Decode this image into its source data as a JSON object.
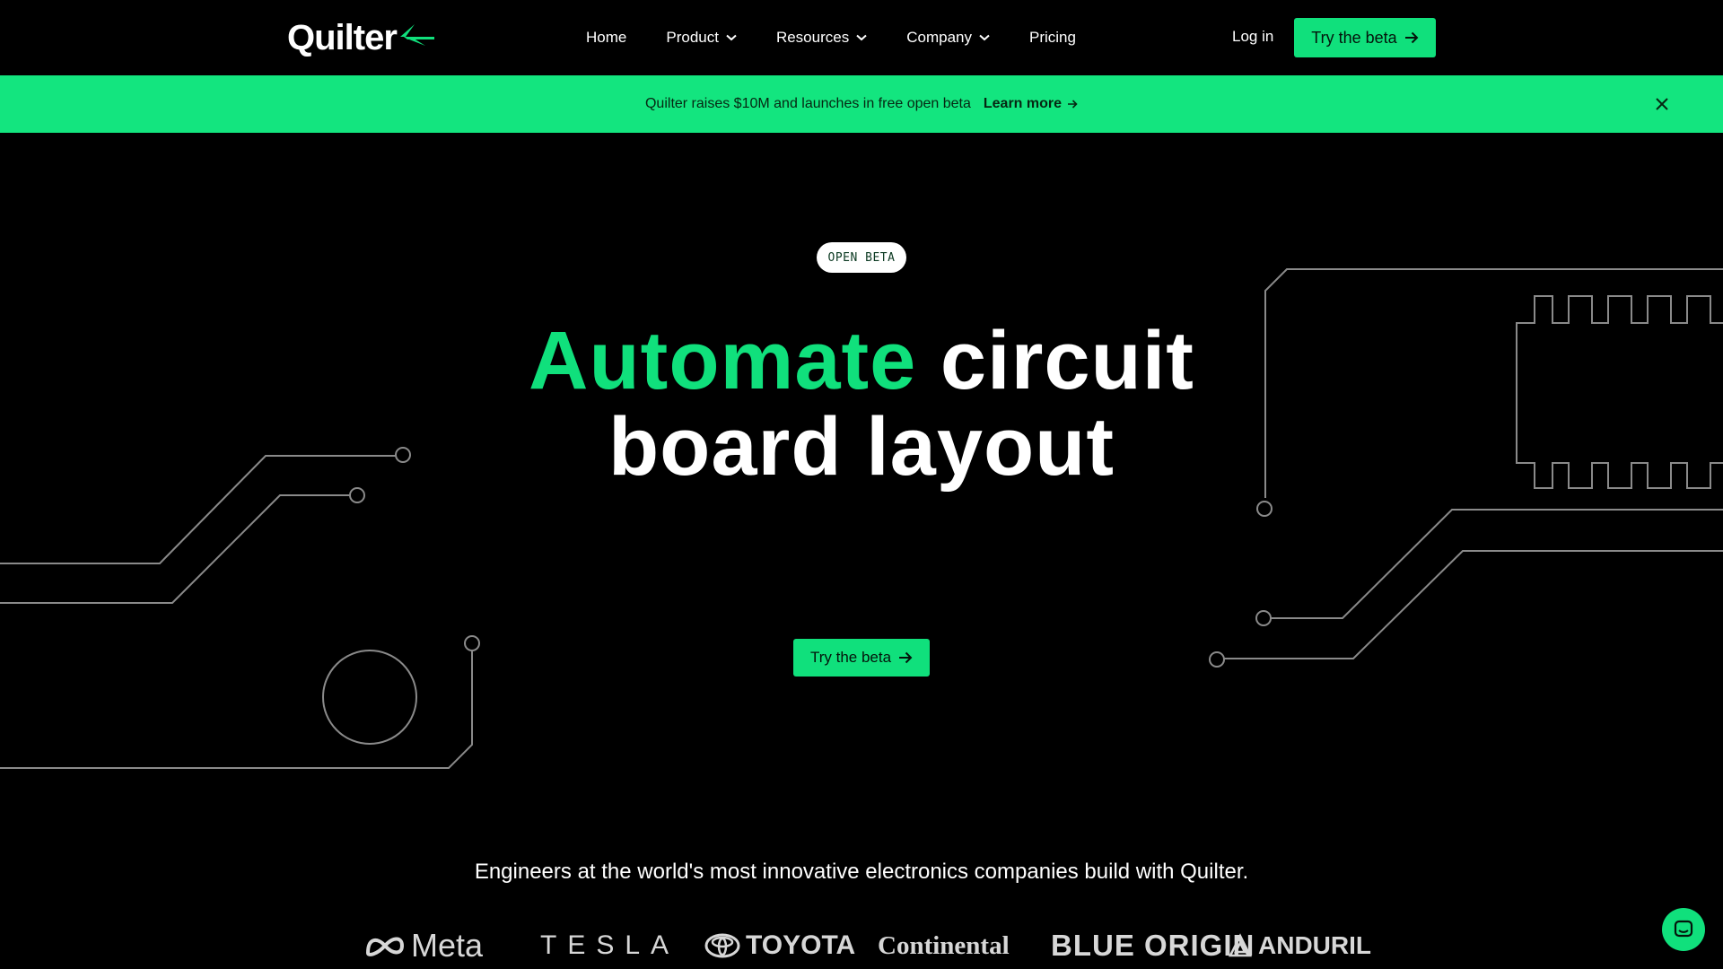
{
  "nav": {
    "logo_text": "Quilter",
    "links": [
      {
        "label": "Home",
        "has_menu": false
      },
      {
        "label": "Product",
        "has_menu": true
      },
      {
        "label": "Resources",
        "has_menu": true
      },
      {
        "label": "Company",
        "has_menu": true
      },
      {
        "label": "Pricing",
        "has_menu": false
      }
    ],
    "login_label": "Log in",
    "cta_label": "Try the beta"
  },
  "banner": {
    "text": "Quilter raises $10M and launches in free open beta",
    "link_label": "Learn more"
  },
  "hero": {
    "badge": "OPEN BETA",
    "headline_accent": "Automate",
    "headline_rest_1": " circuit",
    "headline_line_2": "board layout",
    "cta_label": "Try the beta"
  },
  "customers": {
    "tagline": "Engineers at the world's most innovative electronics companies build with Quilter.",
    "logos": [
      "Meta",
      "TESLA",
      "TOYOTA",
      "Continental",
      "BLUE ORIGIN",
      "ANDURIL"
    ]
  },
  "colors": {
    "accent": "#10e07c",
    "banner_bg": "#13e57f",
    "background": "#000000",
    "circuit_line": "#8a8a8a"
  },
  "icons": [
    "quilter-logo-mark",
    "chevron-down-icon",
    "arrow-right-icon",
    "close-icon",
    "chat-icon"
  ]
}
